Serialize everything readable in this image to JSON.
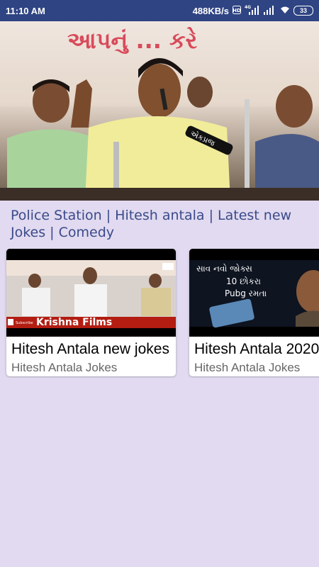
{
  "status_bar": {
    "time": "11:10 AM",
    "speed": "488KB/s",
    "network": "4G",
    "battery": "33"
  },
  "hero": {
    "banner_text": "આપનું ... કરે",
    "mic_label": "એકપ્રજ"
  },
  "video": {
    "title": "Police Station | Hitesh antala | Latest new Jokes | Comedy"
  },
  "related": [
    {
      "title": "Hitesh Antala new jokes",
      "channel": "Hitesh Antala Jokes",
      "thumb_caption": "Krishna Films",
      "thumb_subscribe": "Subscribe"
    },
    {
      "title": "Hitesh Antala 2020",
      "channel": "Hitesh Antala Jokes",
      "thumb_line1": "સાવ નવો જોક્સ",
      "thumb_line2": "10 છોકરા",
      "thumb_line3": "Pubg રમતા"
    }
  ],
  "colors": {
    "status_bar": "#2f4483",
    "background": "#e1daf0",
    "title_text": "#3a4a8a"
  }
}
